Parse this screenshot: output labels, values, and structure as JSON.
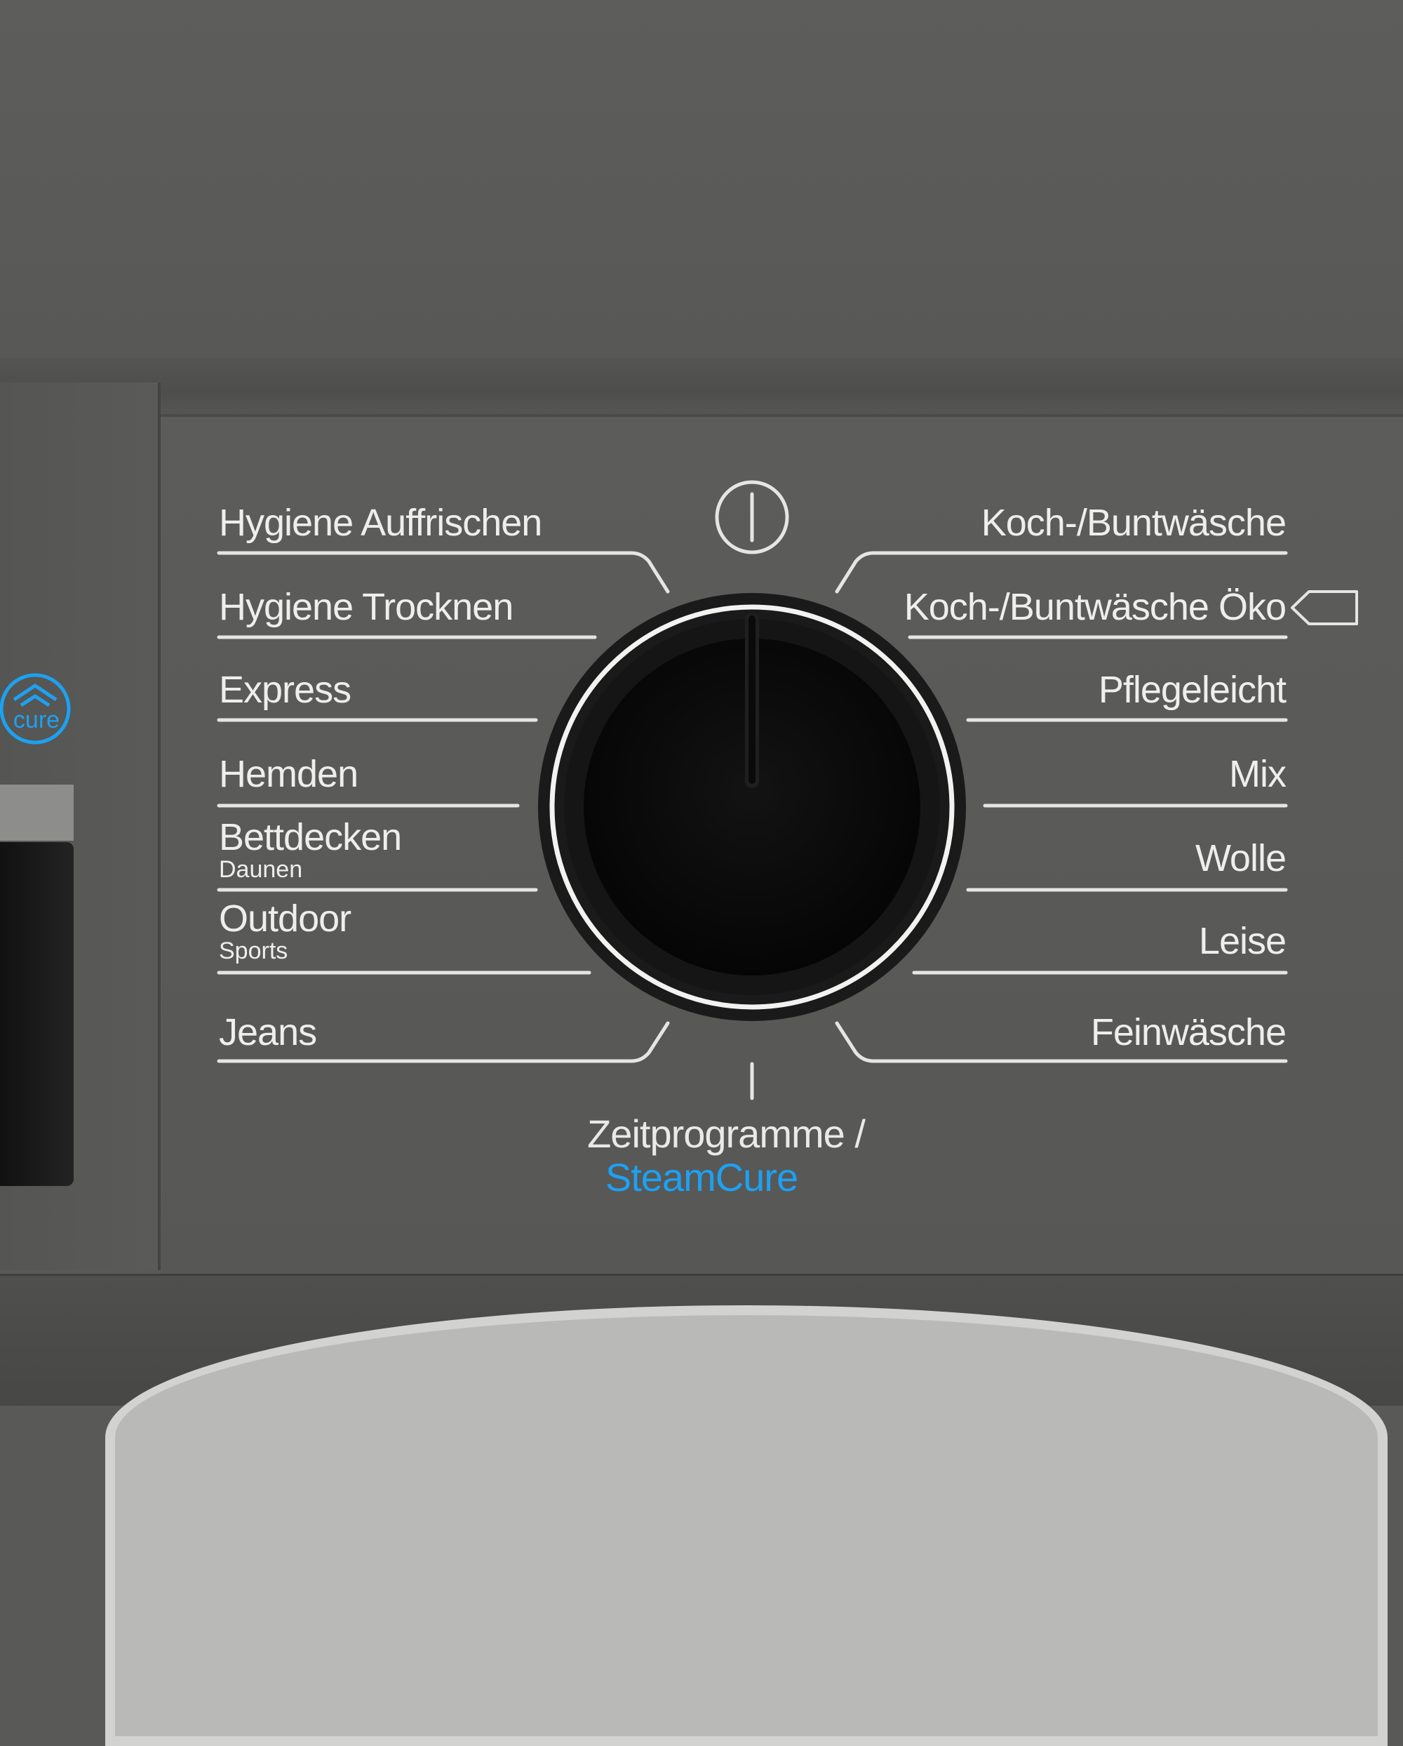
{
  "left_programs": [
    {
      "label": "Hygiene Auffrischen",
      "sub": ""
    },
    {
      "label": "Hygiene Trocknen",
      "sub": ""
    },
    {
      "label": "Express",
      "sub": ""
    },
    {
      "label": "Hemden",
      "sub": ""
    },
    {
      "label": "Bettdecken",
      "sub": "Daunen"
    },
    {
      "label": "Outdoor",
      "sub": "Sports"
    },
    {
      "label": "Jeans",
      "sub": ""
    }
  ],
  "right_programs": [
    {
      "label": "Koch-/Buntwäsche"
    },
    {
      "label": "Koch-/Buntwäsche Öko"
    },
    {
      "label": "Pflegeleicht"
    },
    {
      "label": "Mix"
    },
    {
      "label": "Wolle"
    },
    {
      "label": "Leise"
    },
    {
      "label": "Feinwäsche"
    }
  ],
  "bottom_program": {
    "line1": "Zeitprogramme /",
    "line2": "SteamCure"
  },
  "badge": {
    "text": "cure",
    "icon": "steam-cure-icon"
  },
  "icons": {
    "power": "power-icon",
    "eco": "eco-tag-icon"
  },
  "colors": {
    "panel": "#595957",
    "text": "#eeeeec",
    "accent_blue": "#1da1f2",
    "knob": "#0d0d0d"
  }
}
